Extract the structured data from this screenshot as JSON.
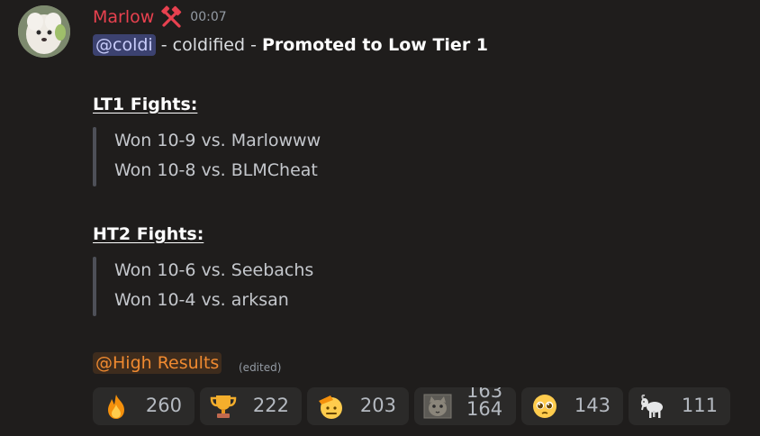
{
  "message": {
    "author": "Marlow",
    "timestamp": "00:07",
    "mention": "@coldi",
    "text_part": "- coldified -",
    "bold_part": "Promoted to Low Tier 1"
  },
  "sections": [
    {
      "heading": "LT1 Fights:",
      "lines": [
        "Won 10-9 vs. Marlowww",
        "Won 10-8 vs. BLMCheat"
      ]
    },
    {
      "heading": "HT2 Fights:",
      "lines": [
        "Won 10-6 vs. Seebachs",
        "Won 10-4 vs. arksan"
      ]
    }
  ],
  "role_mention": "@High Results",
  "edited_label": "(edited)",
  "reactions": [
    {
      "icon": "fire-icon",
      "count": "260"
    },
    {
      "icon": "trophy-icon",
      "count": "222"
    },
    {
      "icon": "saluting-face-icon",
      "count": "203"
    },
    {
      "icon": "cat-sticker-icon",
      "count": "164",
      "previous_count": "163"
    },
    {
      "icon": "pleading-face-icon",
      "count": "143"
    },
    {
      "icon": "goat-icon",
      "count": "111"
    }
  ],
  "colors": {
    "background": "#1f1d1c",
    "username": "#e8414f",
    "mention_bg": "#3c4270",
    "role_mention_text": "#f08a30",
    "reaction_bg": "#2b2a29"
  }
}
